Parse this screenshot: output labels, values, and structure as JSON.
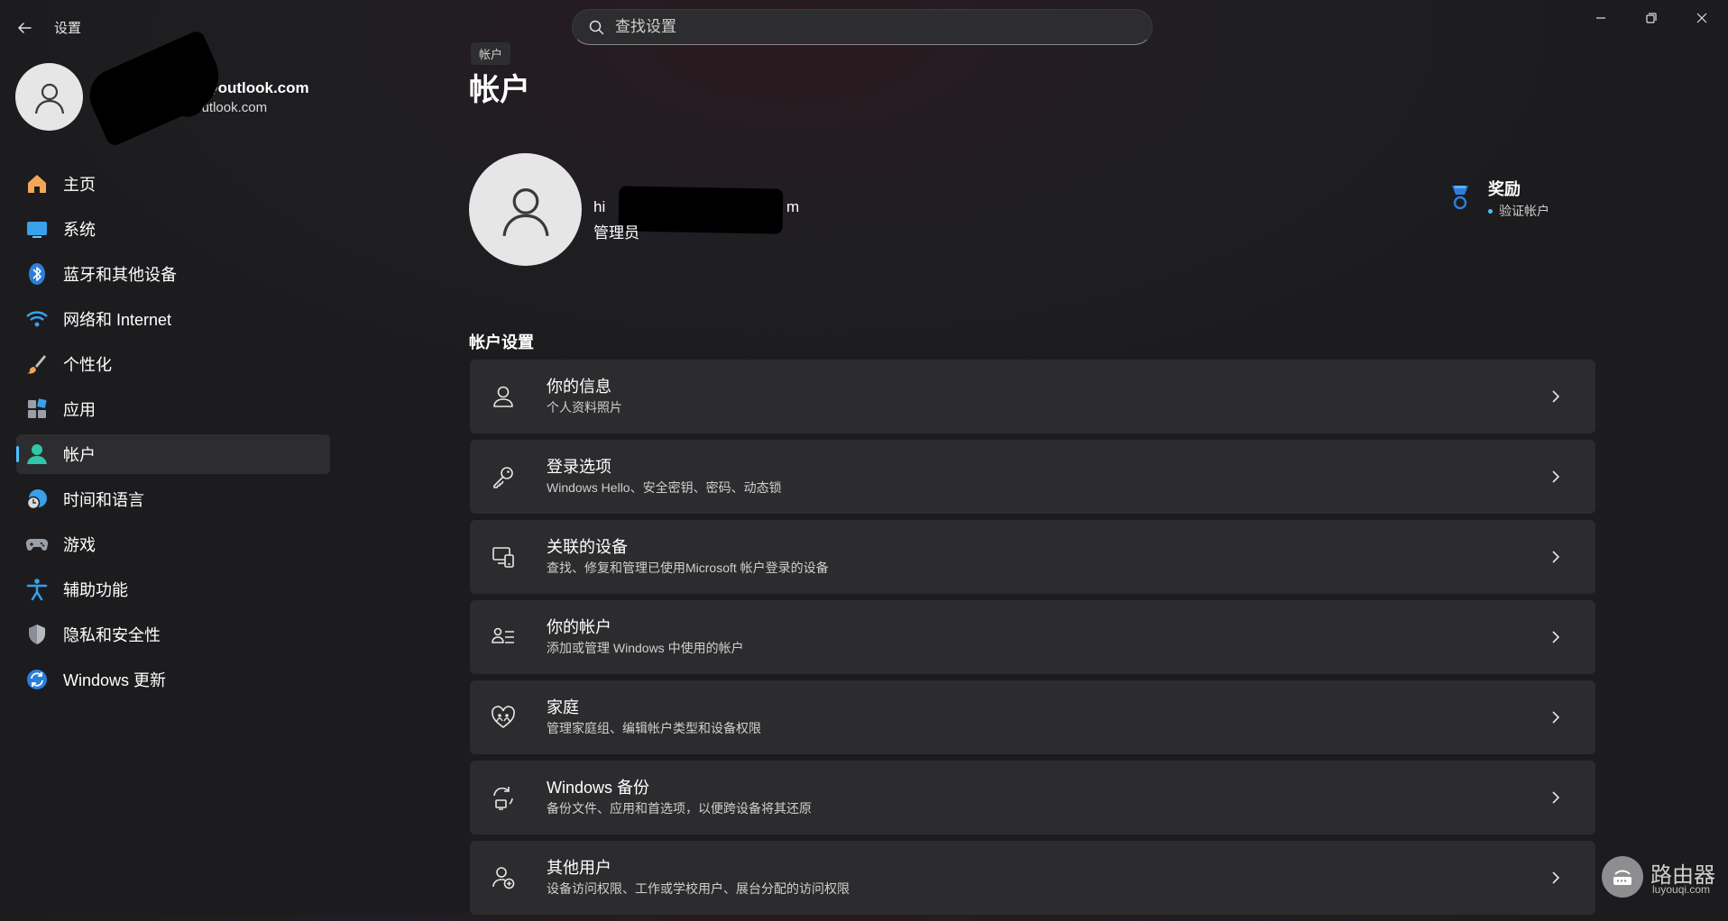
{
  "window": {
    "title": "设置"
  },
  "search": {
    "placeholder": "查找设置"
  },
  "profile": {
    "email_primary": "@outlook.com",
    "email_secondary": "@outlook.com"
  },
  "sidebar": {
    "items": [
      {
        "label": "主页",
        "icon": "home-icon"
      },
      {
        "label": "系统",
        "icon": "monitor-icon"
      },
      {
        "label": "蓝牙和其他设备",
        "icon": "bluetooth-icon"
      },
      {
        "label": "网络和 Internet",
        "icon": "wifi-icon"
      },
      {
        "label": "个性化",
        "icon": "brush-icon"
      },
      {
        "label": "应用",
        "icon": "apps-icon"
      },
      {
        "label": "帐户",
        "icon": "user-icon",
        "active": true
      },
      {
        "label": "时间和语言",
        "icon": "globe-clock-icon"
      },
      {
        "label": "游戏",
        "icon": "gamepad-icon"
      },
      {
        "label": "辅助功能",
        "icon": "accessibility-icon"
      },
      {
        "label": "隐私和安全性",
        "icon": "shield-icon"
      },
      {
        "label": "Windows 更新",
        "icon": "update-icon"
      }
    ]
  },
  "main": {
    "breadcrumb": "帐户",
    "title": "帐户",
    "account": {
      "email_start": "hi",
      "email_end": "m",
      "role": "管理员"
    },
    "rewards": {
      "title": "奖励",
      "subtitle": "验证帐户"
    },
    "section_title": "帐户设置",
    "cards": [
      {
        "title": "你的信息",
        "subtitle": "个人资料照片",
        "icon": "person-icon"
      },
      {
        "title": "登录选项",
        "subtitle": "Windows Hello、安全密钥、密码、动态锁",
        "icon": "key-icon"
      },
      {
        "title": "关联的设备",
        "subtitle": "查找、修复和管理已使用Microsoft 帐户登录的设备",
        "icon": "devices-icon"
      },
      {
        "title": "你的帐户",
        "subtitle": "添加或管理 Windows 中使用的帐户",
        "icon": "account-list-icon"
      },
      {
        "title": "家庭",
        "subtitle": "管理家庭组、编辑帐户类型和设备权限",
        "icon": "family-heart-icon"
      },
      {
        "title": "Windows 备份",
        "subtitle": "备份文件、应用和首选项，以便跨设备将其还原",
        "icon": "backup-icon"
      },
      {
        "title": "其他用户",
        "subtitle": "设备访问权限、工作或学校用户、展台分配的访问权限",
        "icon": "add-user-icon"
      }
    ]
  },
  "watermark": {
    "text": "路由器",
    "url": "luyouqi.com"
  },
  "colors": {
    "accent": "#4cc2ff",
    "card_bg": "#2c2c2e",
    "background": "#1c1c1e"
  }
}
